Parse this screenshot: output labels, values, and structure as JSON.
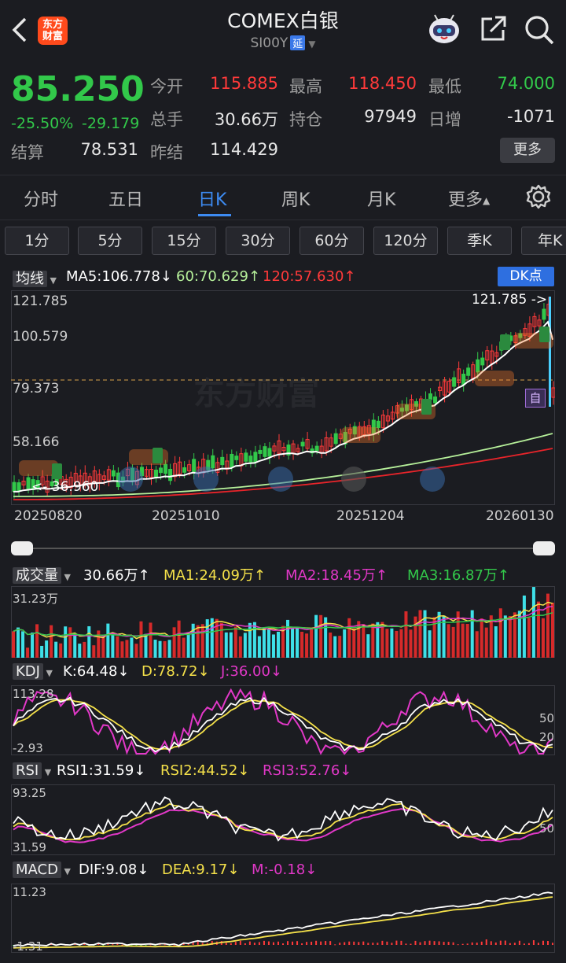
{
  "header": {
    "title": "COMEX白银",
    "code": "SI00Y",
    "delay_badge": "延",
    "logo_text": "东方财富"
  },
  "quote": {
    "price": "85.250",
    "change_pct": "-25.50%",
    "change": "-29.179",
    "open_label": "今开",
    "open": "115.885",
    "high_label": "最高",
    "high": "118.450",
    "low_label": "最低",
    "low": "74.000",
    "volume_label": "总手",
    "volume": "30.66万",
    "oi_label": "持仓",
    "oi": "97949",
    "daily_inc_label": "日增",
    "daily_inc": "-1071",
    "settle_label": "结算",
    "settle": "78.531",
    "prev_settle_label": "昨结",
    "prev_settle": "114.429",
    "more": "更多"
  },
  "tabs": [
    "分时",
    "五日",
    "日K",
    "周K",
    "月K",
    "更多"
  ],
  "active_tab": "日K",
  "periods": [
    "1分",
    "5分",
    "15分",
    "30分",
    "60分",
    "120分",
    "季K",
    "年K"
  ],
  "main_chart": {
    "indicator": "均线",
    "ma5": "MA5:106.778",
    "ma60": "60:70.629",
    "ma120": "120:57.630",
    "dk_button": "DK点",
    "y_labels": [
      "121.785",
      "100.579",
      "79.373",
      "58.166"
    ],
    "max_marker": "121.785",
    "min_marker": "36.960",
    "dates": [
      "20250820",
      "20251010",
      "20251204",
      "20260130"
    ],
    "watermark": "东方财富",
    "badge_zi": "自"
  },
  "volume": {
    "label": "成交量",
    "value": "30.66万",
    "ma1": "MA1:24.09万",
    "ma2": "MA2:18.45万",
    "ma3": "MA3:16.87万",
    "top": "31.23万"
  },
  "kdj": {
    "label": "KDJ",
    "k": "K:64.48",
    "d": "D:78.72",
    "j": "J:36.00",
    "top": "113.28",
    "bottom": "-2.93",
    "r1": "50",
    "r2": "20"
  },
  "rsi": {
    "label": "RSI",
    "rsi1": "RSI1:31.59",
    "rsi2": "RSI2:44.52",
    "rsi3": "RSI3:52.76",
    "top": "93.25",
    "bottom": "31.59",
    "r": "50"
  },
  "macd": {
    "label": "MACD",
    "dif": "DIF:9.08",
    "dea": "DEA:9.17",
    "m": "M:-0.18",
    "top": "11.23",
    "bottom": "-1.31"
  },
  "colors": {
    "up": "#ff3a3a",
    "down": "#32c84a",
    "accent": "#3d8bf2",
    "ma5": "#ffffff",
    "ma60": "#b6f09a",
    "ma120": "#e8242a",
    "bg": "#1b1c21"
  },
  "icons": [
    "back-icon",
    "robot-icon",
    "share-icon",
    "search-icon",
    "gear-icon"
  ]
}
